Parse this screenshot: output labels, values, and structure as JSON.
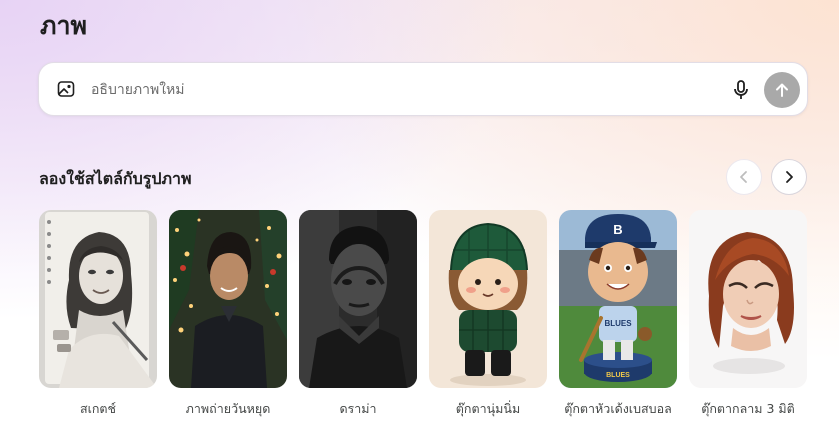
{
  "page": {
    "title": "ภาพ"
  },
  "prompt": {
    "placeholder": "อธิบายภาพใหม่",
    "value": "",
    "image_icon": "image-icon",
    "mic_icon": "microphone-icon",
    "send_icon": "arrow-up-icon"
  },
  "styles_section": {
    "title": "ลองใช้สไตล์กับรูปภาพ",
    "prev_icon": "chevron-left-icon",
    "next_icon": "chevron-right-icon",
    "cards": [
      {
        "label": "สเกตช์"
      },
      {
        "label": "ภาพถ่ายวันหยุด"
      },
      {
        "label": "ดราม่า"
      },
      {
        "label": "ตุ๊กตานุ่มนิ่ม"
      },
      {
        "label": "ตุ๊กตาหัวเด้งเบสบอล",
        "jersey_text": "BLUES",
        "cap_letter": "B"
      },
      {
        "label": "ตุ๊กตากลาม 3 มิติ"
      }
    ]
  },
  "colors": {
    "send_button": "#a9a9a9",
    "text_primary": "#1f1f1f",
    "label_text": "#444746"
  }
}
